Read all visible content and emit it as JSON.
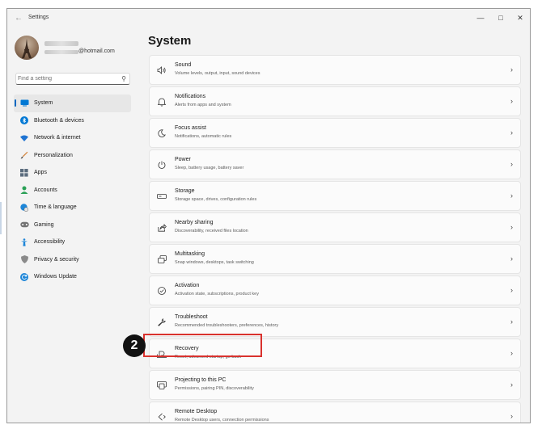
{
  "window": {
    "title": "Settings"
  },
  "user": {
    "email_suffix": "@hotmail.com"
  },
  "search": {
    "placeholder": "Find a setting"
  },
  "nav": {
    "items": [
      {
        "label": "System",
        "icon": "system-icon",
        "active": true
      },
      {
        "label": "Bluetooth & devices",
        "icon": "bluetooth-icon"
      },
      {
        "label": "Network & internet",
        "icon": "wifi-icon"
      },
      {
        "label": "Personalization",
        "icon": "brush-icon"
      },
      {
        "label": "Apps",
        "icon": "apps-icon"
      },
      {
        "label": "Accounts",
        "icon": "person-icon"
      },
      {
        "label": "Time & language",
        "icon": "globe-clock-icon"
      },
      {
        "label": "Gaming",
        "icon": "gamepad-icon"
      },
      {
        "label": "Accessibility",
        "icon": "accessibility-icon"
      },
      {
        "label": "Privacy & security",
        "icon": "shield-icon"
      },
      {
        "label": "Windows Update",
        "icon": "update-icon"
      }
    ]
  },
  "main": {
    "title": "System",
    "items": [
      {
        "title": "Sound",
        "desc": "Volume levels, output, input, sound devices",
        "icon": "speaker-icon"
      },
      {
        "title": "Notifications",
        "desc": "Alerts from apps and system",
        "icon": "bell-icon"
      },
      {
        "title": "Focus assist",
        "desc": "Notifications, automatic rules",
        "icon": "moon-icon"
      },
      {
        "title": "Power",
        "desc": "Sleep, battery usage, battery saver",
        "icon": "power-icon"
      },
      {
        "title": "Storage",
        "desc": "Storage space, drives, configuration rules",
        "icon": "drive-icon"
      },
      {
        "title": "Nearby sharing",
        "desc": "Discoverability, received files location",
        "icon": "share-icon"
      },
      {
        "title": "Multitasking",
        "desc": "Snap windows, desktops, task switching",
        "icon": "multitask-icon"
      },
      {
        "title": "Activation",
        "desc": "Activation state, subscriptions, product key",
        "icon": "check-circle-icon"
      },
      {
        "title": "Troubleshoot",
        "desc": "Recommended troubleshooters, preferences, history",
        "icon": "wrench-icon"
      },
      {
        "title": "Recovery",
        "desc": "Reset, advanced startup, go back",
        "icon": "recovery-icon"
      },
      {
        "title": "Projecting to this PC",
        "desc": "Permissions, pairing PIN, discoverability",
        "icon": "projector-icon"
      },
      {
        "title": "Remote Desktop",
        "desc": "Remote Desktop users, connection permissions",
        "icon": "remote-desktop-icon"
      }
    ]
  },
  "annotation": {
    "step": "2",
    "color": "#d9322e"
  },
  "colors": {
    "accent": "#0067c0",
    "background": "#f3f3f3",
    "card": "#fbfbfb"
  }
}
